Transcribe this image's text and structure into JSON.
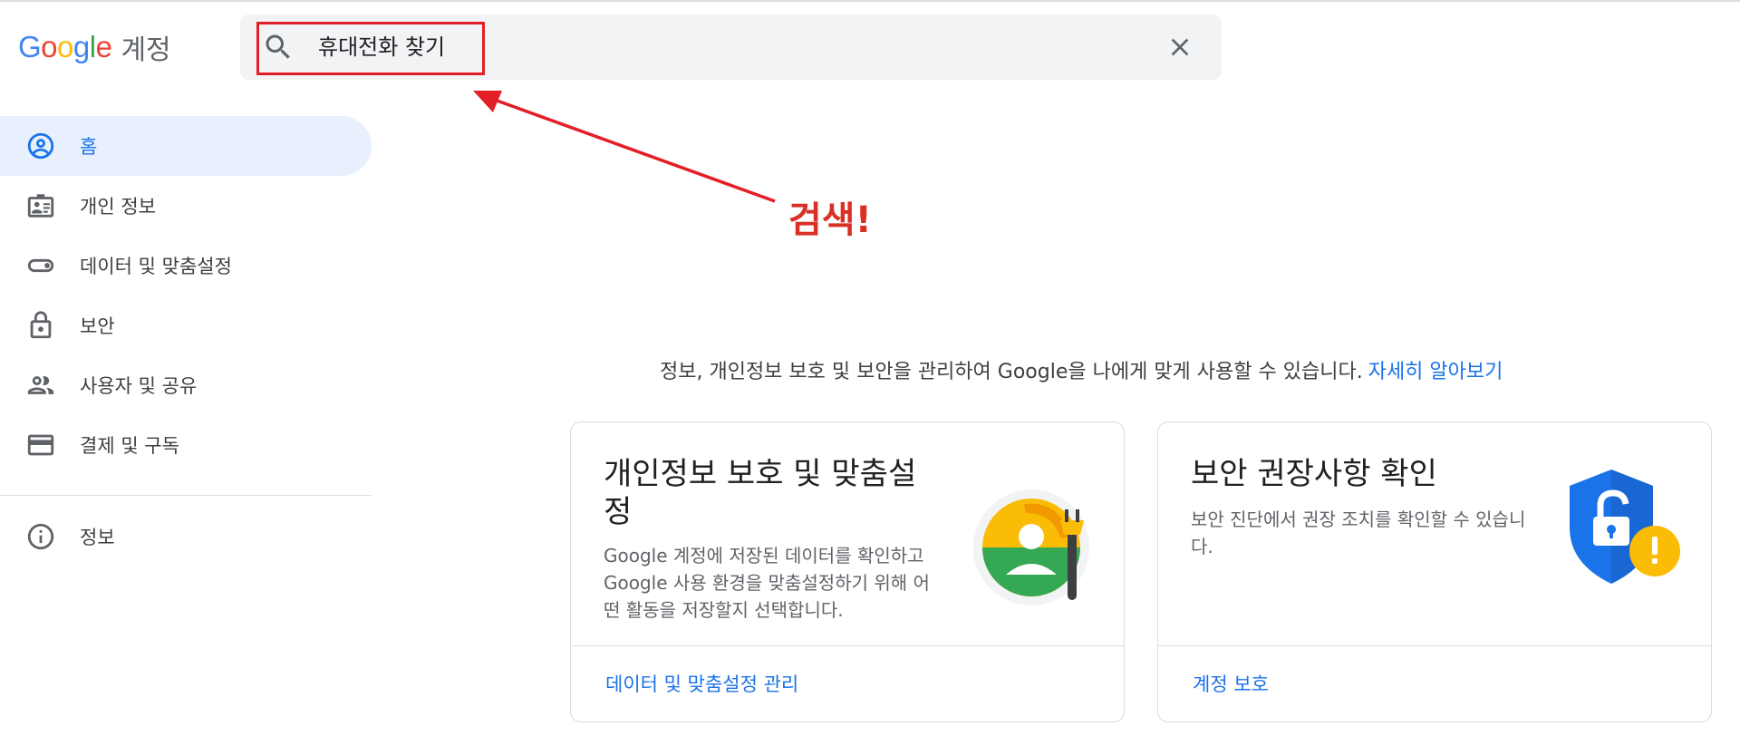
{
  "header": {
    "logo_text": "Google",
    "product": "계정",
    "search": {
      "value": "휴대전화 찾기"
    }
  },
  "annotation": {
    "text": "검색!"
  },
  "sidebar": {
    "items": [
      {
        "label": "홈",
        "icon": "account-circle-icon",
        "active": true
      },
      {
        "label": "개인 정보",
        "icon": "id-card-icon"
      },
      {
        "label": "데이터 및 맞춤설정",
        "icon": "toggle-icon"
      },
      {
        "label": "보안",
        "icon": "lock-icon"
      },
      {
        "label": "사용자 및 공유",
        "icon": "people-icon"
      },
      {
        "label": "결제 및 구독",
        "icon": "credit-card-icon"
      },
      {
        "label": "정보",
        "icon": "info-icon"
      }
    ]
  },
  "main": {
    "intro_text": "정보, 개인정보 보호 및 보안을 관리하여 Google을 나에게 맞게 사용할 수 있습니다.",
    "intro_link": "자세히 알아보기",
    "cards": [
      {
        "title": "개인정보 보호 및 맞춤설정",
        "description": "Google 계정에 저장된 데이터를 확인하고 Google 사용 환경을 맞춤설정하기 위해 어떤 활동을 저장할지 선택합니다.",
        "link": "데이터 및 맞춤설정 관리"
      },
      {
        "title": "보안 권장사항 확인",
        "description": "보안 진단에서 권장 조치를 확인할 수 있습니다.",
        "link": "계정 보호"
      }
    ]
  },
  "colors": {
    "accent": "#1a73e8",
    "active_bg": "#e8f0fe",
    "annotation": "#e41e26"
  }
}
